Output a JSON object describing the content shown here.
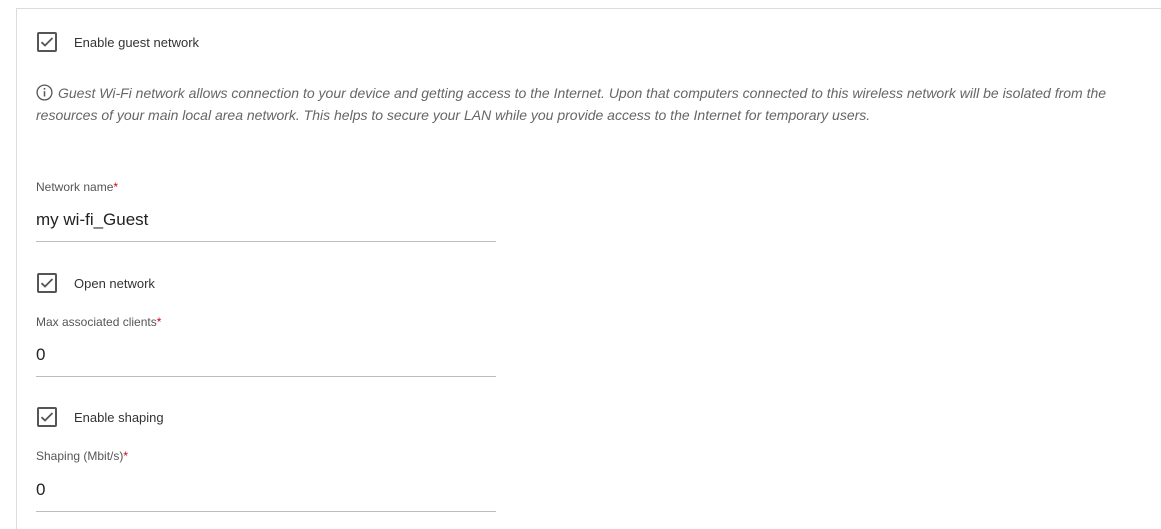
{
  "guest_network": {
    "enable_label": "Enable guest network",
    "enable_checked": true,
    "info_text": "Guest Wi-Fi network allows connection to your device and getting access to the Internet. Upon that computers connected to this wireless network will be isolated from the resources of your main local area network. This helps to secure your LAN while you provide access to the Internet for temporary users.",
    "info_icon": "info-icon"
  },
  "network_name": {
    "label": "Network name",
    "required_mark": "*",
    "value": "my wi-fi_Guest"
  },
  "open_network": {
    "label": "Open network",
    "checked": true
  },
  "max_clients": {
    "label": "Max associated clients",
    "required_mark": "*",
    "value": "0"
  },
  "shaping": {
    "enable_label": "Enable shaping",
    "enable_checked": true,
    "label": "Shaping (Mbit/s)",
    "required_mark": "*",
    "value": "0"
  },
  "colors": {
    "required": "#d0021b",
    "checkbox_border": "#555555",
    "underline": "#bdbdbd"
  }
}
